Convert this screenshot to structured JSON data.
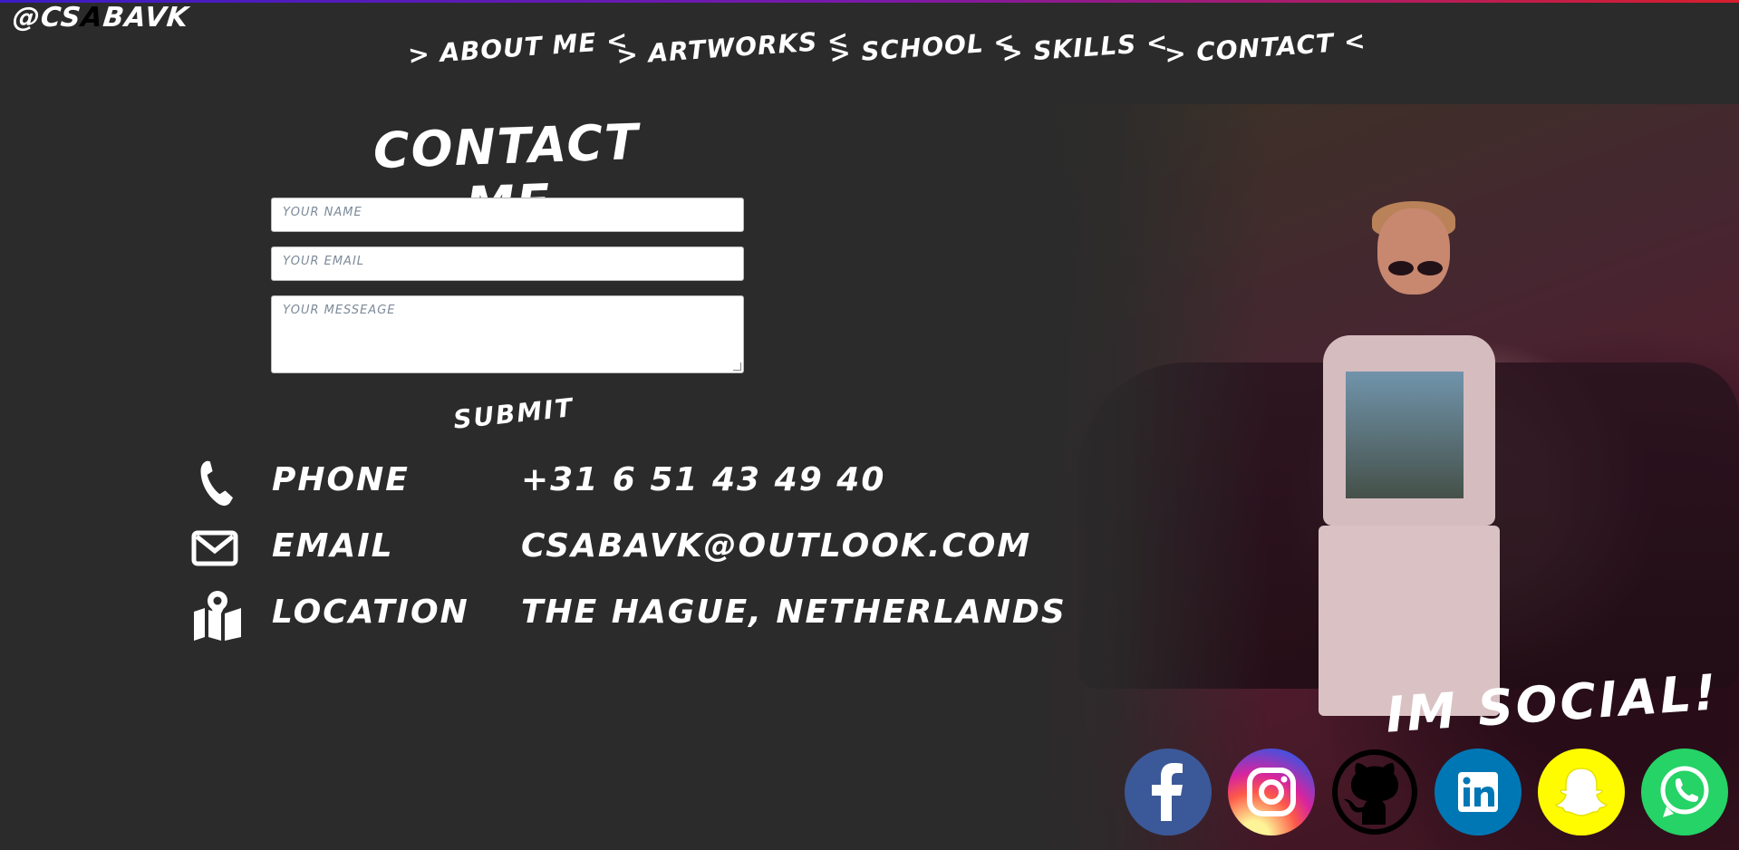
{
  "brand": {
    "logo_prefix": "@CS",
    "logo_highlight": "A",
    "logo_suffix": "BAVK"
  },
  "nav": {
    "items": [
      {
        "label": "> ABOUT ME <"
      },
      {
        "label": "> ARTWORKS <"
      },
      {
        "label": "> SCHOOL <"
      },
      {
        "label": "> SKILLS <"
      },
      {
        "label": "> CONTACT <"
      }
    ]
  },
  "contact": {
    "title": "CONTACT ME",
    "name_placeholder": "YOUR NAME",
    "email_placeholder": "YOUR EMAIL",
    "message_placeholder": "YOUR MESSEAGE",
    "submit_label": "SUBMIT"
  },
  "info": [
    {
      "icon": "phone-icon",
      "label": "PHONE",
      "value": "+31 6 51 43 49 40"
    },
    {
      "icon": "email-icon",
      "label": "EMAIL",
      "value": "CSABAVK@OUTLOOK.COM"
    },
    {
      "icon": "map-location-icon",
      "label": "LOCATION",
      "value": "THE HAGUE, NETHERLANDS"
    }
  ],
  "social": {
    "title": "IM SOCIAL!",
    "links": [
      {
        "icon": "facebook-icon",
        "color": "#3b5998"
      },
      {
        "icon": "instagram-icon",
        "color": "#d6249f"
      },
      {
        "icon": "github-icon",
        "color": "#000000"
      },
      {
        "icon": "linkedin-icon",
        "color": "#0077b5"
      },
      {
        "icon": "snapchat-icon",
        "color": "#fffc00"
      },
      {
        "icon": "whatsapp-icon",
        "color": "#25d366"
      }
    ]
  },
  "colors": {
    "background": "#2b2b2b",
    "text": "#ffffff"
  }
}
